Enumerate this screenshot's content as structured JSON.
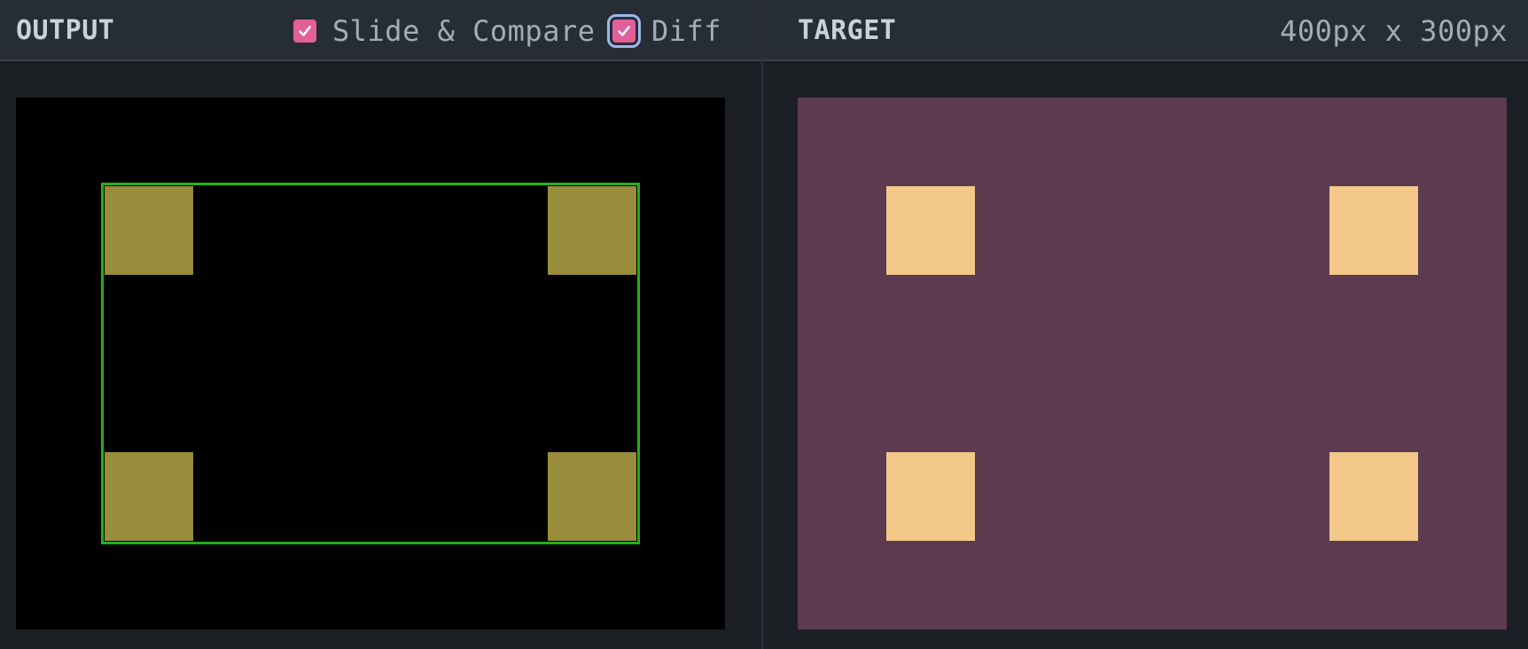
{
  "output_pane": {
    "title": "OUTPUT",
    "options": {
      "slide_compare": {
        "label": "Slide & Compare",
        "checked": true
      },
      "diff": {
        "label": "Diff",
        "checked": true,
        "focused": true
      }
    },
    "canvas": {
      "background": "#000000",
      "outline_color": "#22b115",
      "square_color": "#978d3a"
    }
  },
  "target_pane": {
    "title": "TARGET",
    "dimensions": "400px x 300px",
    "canvas": {
      "background": "#5c3a4f",
      "square_color": "#f3c889"
    }
  },
  "colors": {
    "header_bg": "#272d35",
    "app_bg": "#1b1f23",
    "checkbox_accent": "#e2609a",
    "focus_ring": "#9fb8ec"
  },
  "icons": {
    "checkbox_check": "check-icon"
  }
}
